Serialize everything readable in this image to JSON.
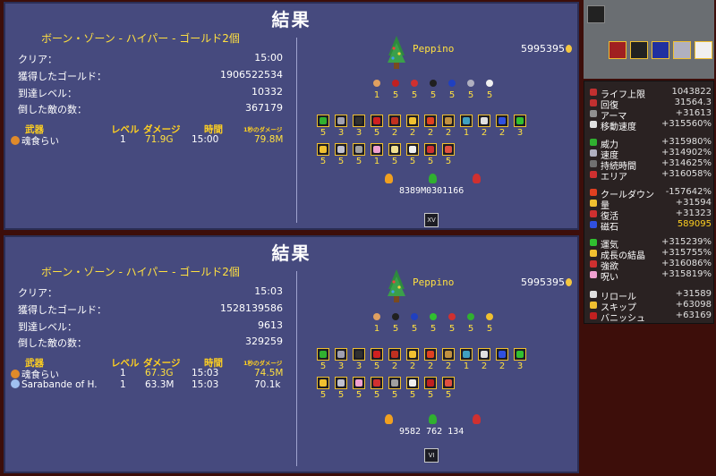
{
  "panels": [
    {
      "title": "結果",
      "stage": "ボーン・ゾーン - ハイパー - ゴールド2個",
      "stats": [
        {
          "label": "クリア：",
          "value": "15:00"
        },
        {
          "label": "獲得したゴールド：",
          "value": "1906522534"
        },
        {
          "label": "到達レベル：",
          "value": "10332"
        },
        {
          "label": "倒した敵の数：",
          "value": "367179"
        }
      ],
      "weapon_headers": {
        "weapon": "武器",
        "level": "レベル",
        "damage": "ダメージ",
        "time": "時間",
        "dps": "1秒のダメージ"
      },
      "weapons": [
        {
          "name": "魂食らい",
          "level": "1",
          "damage": "71.9G",
          "time": "15:00",
          "dps": "79.8M",
          "icon_color": "#e08a2a"
        }
      ],
      "character": {
        "name": "Peppino"
      },
      "gold": "5995395",
      "passives_top": [
        {
          "count": "1",
          "color": "#e0a060"
        },
        {
          "count": "5",
          "color": "#c02020"
        },
        {
          "count": "5",
          "color": "#d03030"
        },
        {
          "count": "5",
          "color": "#202020"
        },
        {
          "count": "5",
          "color": "#2040c0"
        },
        {
          "count": "5",
          "color": "#b0b0c0"
        },
        {
          "count": "5",
          "color": "#f0f0f0"
        }
      ],
      "items_row1": [
        {
          "count": "5",
          "color": "#30b030"
        },
        {
          "count": "3",
          "color": "#a0a0b0"
        },
        {
          "count": "3",
          "color": "#303030"
        },
        {
          "count": "5",
          "color": "#d02020"
        },
        {
          "count": "2",
          "color": "#c03020"
        },
        {
          "count": "2",
          "color": "#f0c030"
        },
        {
          "count": "2",
          "color": "#e04020"
        },
        {
          "count": "2",
          "color": "#c09040"
        },
        {
          "count": "1",
          "color": "#40a0c0"
        },
        {
          "count": "2",
          "color": "#e0e0e0"
        },
        {
          "count": "2",
          "color": "#3050e0"
        },
        {
          "count": "3",
          "color": "#30c030"
        }
      ],
      "items_row2": [
        {
          "count": "5",
          "color": "#f0c030"
        },
        {
          "count": "5",
          "color": "#c0c0d0"
        },
        {
          "count": "5",
          "color": "#a0a0a0"
        },
        {
          "count": "1",
          "color": "#f0a0d0"
        },
        {
          "count": "5",
          "color": "#f0e090"
        },
        {
          "count": "5",
          "color": "#f0f0f0"
        },
        {
          "count": "5",
          "color": "#d03030"
        },
        {
          "count": "5",
          "color": "#e05040"
        }
      ],
      "pickups": "8389M0301166",
      "arcana": "XV"
    },
    {
      "title": "結果",
      "stage": "ボーン・ゾーン - ハイパー - ゴールド2個",
      "stats": [
        {
          "label": "クリア：",
          "value": "15:03"
        },
        {
          "label": "獲得したゴールド：",
          "value": "1528139586"
        },
        {
          "label": "到達レベル：",
          "value": "9613"
        },
        {
          "label": "倒した敵の数：",
          "value": "329259"
        }
      ],
      "weapon_headers": {
        "weapon": "武器",
        "level": "レベル",
        "damage": "ダメージ",
        "time": "時間",
        "dps": "1秒のダメージ"
      },
      "weapons": [
        {
          "name": "魂食らい",
          "level": "1",
          "damage": "67.3G",
          "time": "15:03",
          "dps": "74.5M",
          "icon_color": "#e08a2a"
        },
        {
          "name": "Sarabande of H.",
          "level": "1",
          "damage": "63.3M",
          "time": "15:03",
          "dps": "70.1k",
          "icon_color": "#a0c0f0"
        }
      ],
      "character": {
        "name": "Peppino"
      },
      "gold": "5995395",
      "passives_top": [
        {
          "count": "1",
          "color": "#e0a060"
        },
        {
          "count": "5",
          "color": "#202020"
        },
        {
          "count": "5",
          "color": "#2040c0"
        },
        {
          "count": "5",
          "color": "#30c030"
        },
        {
          "count": "5",
          "color": "#d03030"
        },
        {
          "count": "5",
          "color": "#30b030"
        },
        {
          "count": "5",
          "color": "#f0c030"
        }
      ],
      "items_row1": [
        {
          "count": "5",
          "color": "#30b030"
        },
        {
          "count": "3",
          "color": "#a0a0b0"
        },
        {
          "count": "3",
          "color": "#303030"
        },
        {
          "count": "5",
          "color": "#d02020"
        },
        {
          "count": "2",
          "color": "#c03020"
        },
        {
          "count": "2",
          "color": "#f0c030"
        },
        {
          "count": "2",
          "color": "#e04020"
        },
        {
          "count": "2",
          "color": "#c09040"
        },
        {
          "count": "1",
          "color": "#40a0c0"
        },
        {
          "count": "2",
          "color": "#e0e0e0"
        },
        {
          "count": "2",
          "color": "#3050e0"
        },
        {
          "count": "3",
          "color": "#30c030"
        }
      ],
      "items_row2": [
        {
          "count": "5",
          "color": "#f0c030"
        },
        {
          "count": "5",
          "color": "#c0c0d0"
        },
        {
          "count": "5",
          "color": "#f0a0d0"
        },
        {
          "count": "5",
          "color": "#d03030"
        },
        {
          "count": "5",
          "color": "#a0a0a0"
        },
        {
          "count": "5",
          "color": "#f0f0f0"
        },
        {
          "count": "5",
          "color": "#c02020"
        },
        {
          "count": "5",
          "color": "#e05040"
        }
      ],
      "pickups": "9582 762 134",
      "arcana": "VI"
    }
  ],
  "side_stats": [
    {
      "label": "ライフ上限",
      "value": "1043822",
      "color": "#c03030",
      "highlight": false
    },
    {
      "label": "回復",
      "value": "31564.3",
      "color": "#c03030",
      "highlight": false
    },
    {
      "label": "アーマ",
      "value": "+31613",
      "color": "#909090",
      "highlight": false
    },
    {
      "label": "移動速度",
      "value": "+315560%",
      "color": "#e0e0e0",
      "highlight": false
    },
    {
      "label": "威力",
      "value": "+315980%",
      "color": "#30b030",
      "highlight": false
    },
    {
      "label": "速度",
      "value": "+314902%",
      "color": "#b0b0c0",
      "highlight": false
    },
    {
      "label": "持続時間",
      "value": "+314625%",
      "color": "#707070",
      "highlight": false
    },
    {
      "label": "エリア",
      "value": "+316058%",
      "color": "#d03030",
      "highlight": false
    },
    {
      "label": "クールダウン",
      "value": "-157642%",
      "color": "#e04020",
      "highlight": false
    },
    {
      "label": "量",
      "value": "+31594",
      "color": "#f0c030",
      "highlight": false
    },
    {
      "label": "復活",
      "value": "+31323",
      "color": "#d03030",
      "highlight": false
    },
    {
      "label": "磁石",
      "value": "589095",
      "color": "#3050e0",
      "highlight": true
    },
    {
      "label": "運気",
      "value": "+315239%",
      "color": "#30c030",
      "highlight": false
    },
    {
      "label": "成長の結晶",
      "value": "+315755%",
      "color": "#f0c030",
      "highlight": false
    },
    {
      "label": "強欲",
      "value": "+316086%",
      "color": "#d03030",
      "highlight": false
    },
    {
      "label": "呪い",
      "value": "+315819%",
      "color": "#f0a0d0",
      "highlight": false
    },
    {
      "label": "リロール",
      "value": "+31589",
      "color": "#e0e0e0",
      "highlight": false
    },
    {
      "label": "スキップ",
      "value": "+63098",
      "color": "#f0c030",
      "highlight": false
    },
    {
      "label": "バニッシュ",
      "value": "+63169",
      "color": "#c02020",
      "highlight": false
    }
  ]
}
